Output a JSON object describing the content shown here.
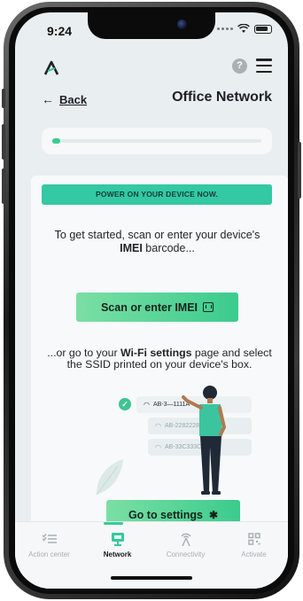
{
  "status_bar": {
    "time": "9:24"
  },
  "header": {
    "back_label": "Back",
    "title": "Office Network",
    "help_glyph": "?",
    "menu_icon": "hamburger-menu-icon"
  },
  "progress": {
    "fraction": 0.04
  },
  "main": {
    "banner": "POWER ON YOUR DEVICE NOW.",
    "intro_pre": "To get started, scan or enter your device's ",
    "intro_bold": "IMEI",
    "intro_post": " barcode...",
    "scan_button_label": "Scan or enter IMEI",
    "alt_pre": "...or go to your ",
    "alt_bold": "Wi-Fi settings",
    "alt_post": " page and select the SSID printed on your device's box.",
    "ssids": [
      "AB-3—1111A",
      "AB-2282228",
      "AB-33C333C"
    ],
    "settings_button_label": "Go to settings"
  },
  "tabs": [
    {
      "label": "Action center",
      "icon": "checklist-icon",
      "active": false
    },
    {
      "label": "Network",
      "icon": "network-icon",
      "active": true
    },
    {
      "label": "Connectivity",
      "icon": "antenna-icon",
      "active": false
    },
    {
      "label": "Activate",
      "icon": "qr-code-icon",
      "active": false
    }
  ],
  "colors": {
    "accent": "#38cc8e",
    "banner": "#34c8a4",
    "active_tab_indicator": "#37c99a"
  }
}
